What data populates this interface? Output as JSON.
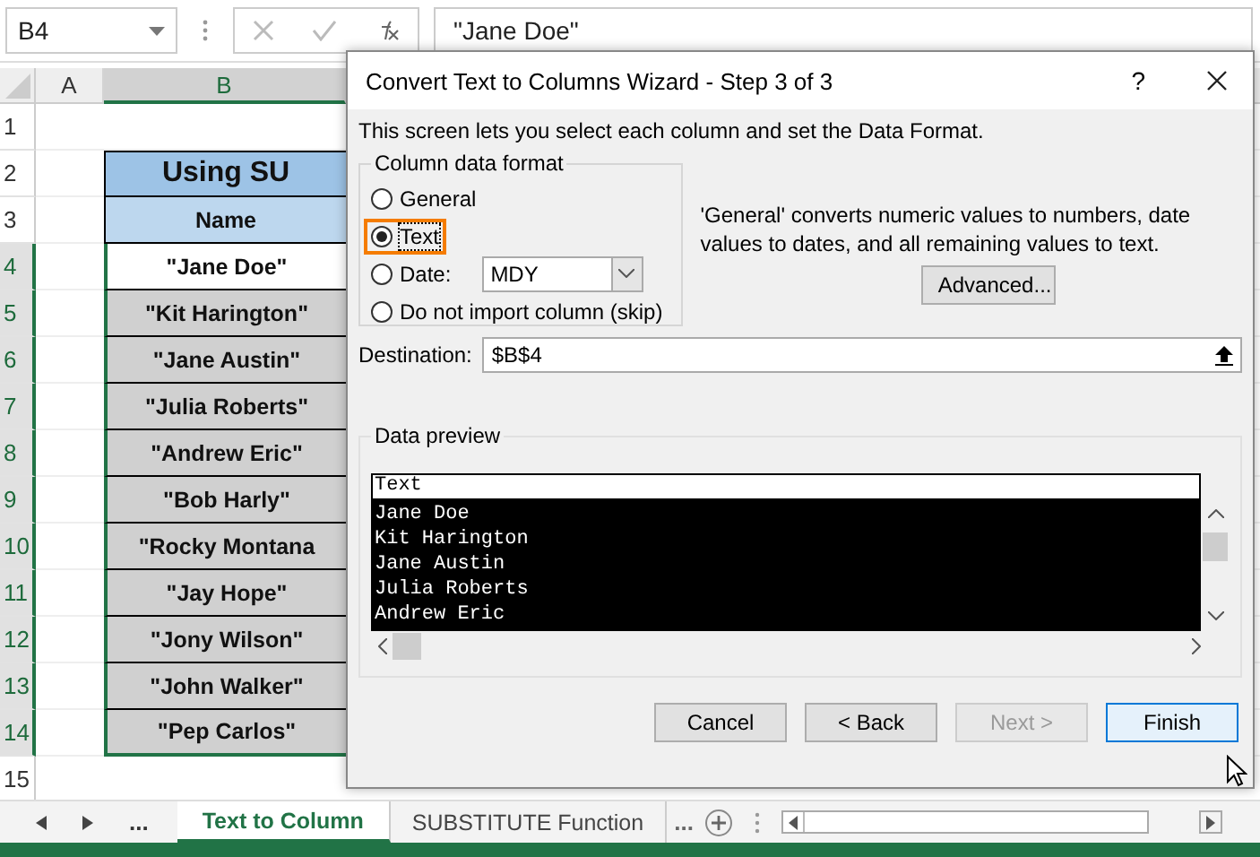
{
  "formula_bar": {
    "name_box": "B4",
    "formula": "\"Jane Doe\""
  },
  "sheet": {
    "columns": [
      {
        "label": "A",
        "selected": false
      },
      {
        "label": "B",
        "selected": true
      }
    ],
    "rows": [
      {
        "number": "1",
        "selected": false,
        "kind": "empty",
        "text": null
      },
      {
        "number": "2",
        "selected": false,
        "kind": "title",
        "text": "Using SU"
      },
      {
        "number": "3",
        "selected": false,
        "kind": "header",
        "text": "Name"
      },
      {
        "number": "4",
        "selected": true,
        "kind": "active",
        "text": "\"Jane Doe\""
      },
      {
        "number": "5",
        "selected": true,
        "kind": "data",
        "text": "\"Kit Harington\""
      },
      {
        "number": "6",
        "selected": true,
        "kind": "data",
        "text": "\"Jane Austin\""
      },
      {
        "number": "7",
        "selected": true,
        "kind": "data",
        "text": "\"Julia Roberts\""
      },
      {
        "number": "8",
        "selected": true,
        "kind": "data",
        "text": "\"Andrew Eric\""
      },
      {
        "number": "9",
        "selected": true,
        "kind": "data",
        "text": "\"Bob Harly\""
      },
      {
        "number": "10",
        "selected": true,
        "kind": "data",
        "text": "\"Rocky Montana"
      },
      {
        "number": "11",
        "selected": true,
        "kind": "data",
        "text": "\"Jay Hope\""
      },
      {
        "number": "12",
        "selected": true,
        "kind": "data",
        "text": "\"Jony Wilson\""
      },
      {
        "number": "13",
        "selected": true,
        "kind": "data",
        "text": "\"John Walker\""
      },
      {
        "number": "14",
        "selected": true,
        "kind": "data",
        "text": "\"Pep Carlos\""
      },
      {
        "number": "15",
        "selected": false,
        "kind": "empty",
        "text": null
      }
    ]
  },
  "dialog": {
    "title": "Convert Text to Columns Wizard - Step 3 of 3",
    "help": "?",
    "intro": "This screen lets you select each column and set the Data Format.",
    "format_group": {
      "legend": "Column data format",
      "options": [
        {
          "label": "General",
          "selected": false,
          "highlighted": false,
          "kind": "plain"
        },
        {
          "label": "Text",
          "selected": true,
          "highlighted": true,
          "kind": "plain"
        },
        {
          "label": "Date:",
          "selected": false,
          "highlighted": false,
          "kind": "date",
          "value": "MDY"
        },
        {
          "label": "Do not import column (skip)",
          "selected": false,
          "highlighted": false,
          "kind": "plain"
        }
      ]
    },
    "description": "'General' converts numeric values to numbers, date values to dates, and all remaining values to text.",
    "advanced_button": "Advanced...",
    "destination": {
      "label": "Destination:",
      "value": "$B$4"
    },
    "preview": {
      "legend": "Data preview",
      "header": "Text",
      "selected": true,
      "rows": [
        "Jane Doe",
        "Kit Harington",
        "Jane Austin",
        "Julia Roberts",
        "Andrew Eric"
      ]
    },
    "buttons": [
      {
        "label": "Cancel",
        "disabled": false,
        "default": false
      },
      {
        "label": "< Back",
        "disabled": false,
        "default": false
      },
      {
        "label": "Next >",
        "disabled": true,
        "default": false
      },
      {
        "label": "Finish",
        "disabled": false,
        "default": true
      }
    ]
  },
  "sheet_tabs": {
    "more": "...",
    "tabs": [
      {
        "label": "Text to Column",
        "selected": true
      },
      {
        "label": "SUBSTITUTE Function",
        "selected": false
      }
    ],
    "overflow": "..."
  }
}
